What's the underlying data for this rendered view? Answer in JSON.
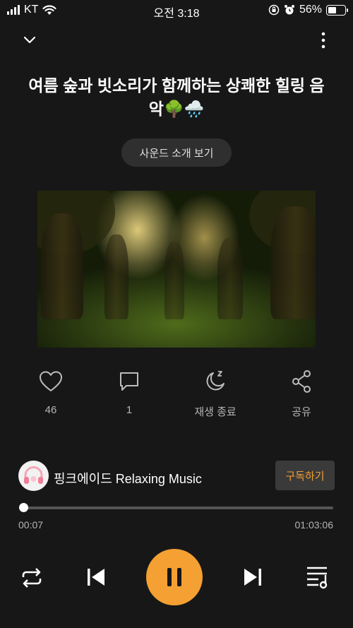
{
  "status": {
    "carrier": "KT",
    "time": "오전 3:18",
    "battery": "56%",
    "battery_level": 0.56
  },
  "header": {
    "collapse_icon": "chevron-down-icon",
    "more_icon": "more-vertical-icon"
  },
  "title": "여름 숲과 빗소리가 함께하는 상쾌한 힐링 음악🌳🌧️",
  "sound_intro_button": "사운드 소개 보기",
  "actions": {
    "like_count": "46",
    "comment_count": "1",
    "sleep_timer_label": "재생 종료",
    "share_label": "공유"
  },
  "channel": {
    "name": "핑크에이드 Relaxing Music",
    "subscribe_label": "구독하기"
  },
  "player": {
    "elapsed": "00:07",
    "duration": "01:03:06",
    "progress": 0.002
  },
  "colors": {
    "accent": "#f4a032",
    "background": "#171717"
  }
}
